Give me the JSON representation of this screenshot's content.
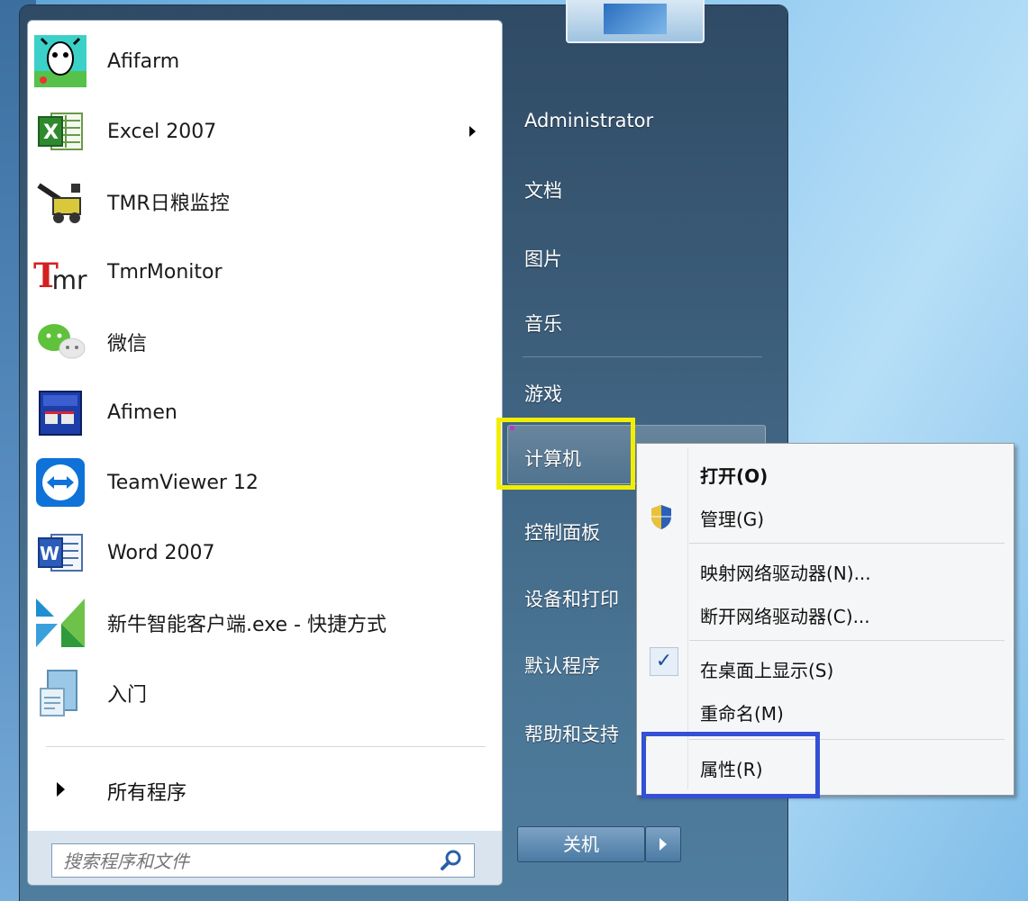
{
  "programs": [
    {
      "label": "Afifarm",
      "icon": "afifarm-cow-icon"
    },
    {
      "label": "Excel 2007",
      "icon": "excel-icon",
      "submenu": true
    },
    {
      "label": "TMR日粮监控",
      "icon": "tmr-crane-icon"
    },
    {
      "label": "TmrMonitor",
      "icon": "tmr-monitor-logo-icon"
    },
    {
      "label": "微信",
      "icon": "wechat-icon"
    },
    {
      "label": "Afimen",
      "icon": "afimen-icon"
    },
    {
      "label": "TeamViewer 12",
      "icon": "teamviewer-icon"
    },
    {
      "label": "Word 2007",
      "icon": "word-icon"
    },
    {
      "label": "新牛智能客户端.exe - 快捷方式",
      "icon": "xinniu-icon"
    },
    {
      "label": "入门",
      "icon": "getting-started-icon"
    }
  ],
  "all_programs": "所有程序",
  "search": {
    "placeholder": "搜索程序和文件"
  },
  "right_pane": {
    "user": "Administrator",
    "documents": "文档",
    "pictures": "图片",
    "music": "音乐",
    "games": "游戏",
    "computer": "计算机",
    "control_panel": "控制面板",
    "devices": "设备和打印",
    "default_programs": "默认程序",
    "help": "帮助和支持"
  },
  "shutdown": {
    "label": "关机"
  },
  "context_menu": {
    "open": "打开(O)",
    "manage": "管理(G)",
    "map_drive": "映射网络驱动器(N)...",
    "disconnect_drive": "断开网络驱动器(C)...",
    "show_on_desktop": "在桌面上显示(S)",
    "rename": "重命名(M)",
    "properties": "属性(R)"
  },
  "colors": {
    "highlight_yellow": "#f2ee00",
    "highlight_blue": "#3350d6"
  }
}
